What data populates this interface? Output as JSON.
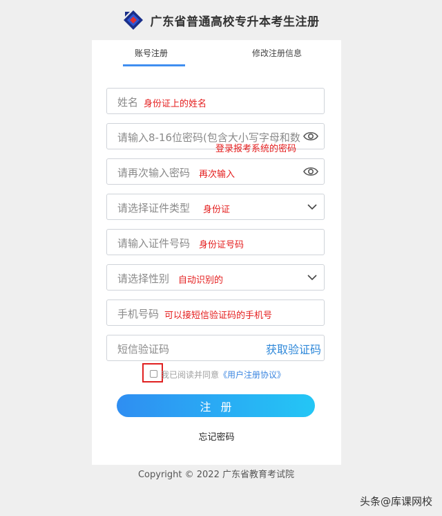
{
  "header": {
    "title": "广东省普通高校专升本考生注册",
    "logo": "diamond-logo"
  },
  "tabs": [
    {
      "label": "账号注册",
      "active": true
    },
    {
      "label": "修改注册信息",
      "active": false
    }
  ],
  "form": {
    "name": {
      "placeholder": "姓名",
      "note": "身份证上的姓名"
    },
    "password": {
      "placeholder": "请输入8-16位密码(包含大小写字母和数",
      "note": "登录报考系统的密码",
      "icon": "eye-icon"
    },
    "confirm_password": {
      "placeholder": "请再次输入密码",
      "note": "再次输入",
      "icon": "eye-icon"
    },
    "id_type": {
      "placeholder": "请选择证件类型",
      "note": "身份证",
      "icon": "chevron-down-icon"
    },
    "id_number": {
      "placeholder": "请输入证件号码",
      "note": "身份证号码"
    },
    "gender": {
      "placeholder": "请选择性别",
      "note": "自动识别的",
      "icon": "chevron-down-icon"
    },
    "phone": {
      "placeholder": "手机号码",
      "note": "可以接短信验证码的手机号"
    },
    "sms_code": {
      "placeholder": "短信验证码",
      "button": "获取验证码"
    }
  },
  "agreement": {
    "text": "我已阅读并同意",
    "link": "《用户注册协议》",
    "checked": false
  },
  "register_button": "注册",
  "forgot_password": "忘记密码",
  "footer": {
    "copyright": "Copyright © 2022 广东省教育考试院"
  },
  "watermark": "头条@库课网校",
  "colors": {
    "accent": "#3f8ef0",
    "note": "#e41d1d",
    "button_start": "#2f8ef2",
    "button_end": "#24c6f5"
  }
}
